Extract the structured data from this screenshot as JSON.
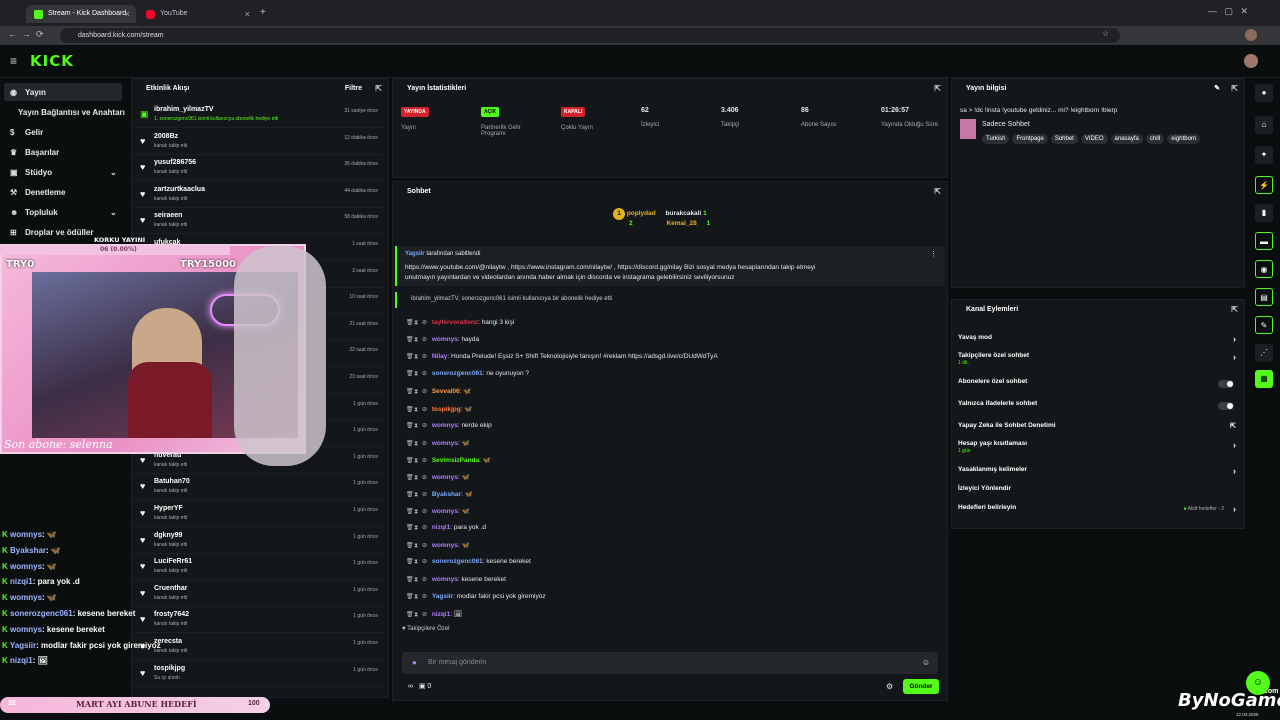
{
  "browser": {
    "tabs": [
      {
        "title": "Stream - Kick Dashboard"
      },
      {
        "title": "YouTube"
      }
    ],
    "url": "dashboard.kick.com/stream"
  },
  "logo": "KICK",
  "sidebar": {
    "items": [
      {
        "label": "Yayın",
        "icon": "broadcast-icon"
      },
      {
        "label": "Yayın Bağlantısı ve Anahtarı",
        "icon": "key-icon"
      },
      {
        "label": "Gelir",
        "icon": "money-icon"
      },
      {
        "label": "Başarılar",
        "icon": "trophy-icon"
      },
      {
        "label": "Stüdyo",
        "icon": "studio-icon"
      },
      {
        "label": "Denetleme",
        "icon": "gavel-icon"
      },
      {
        "label": "Topluluk",
        "icon": "community-icon"
      },
      {
        "label": "Droplar ve ödüller",
        "icon": "gift-icon"
      }
    ]
  },
  "activity": {
    "title": "Etkinlik Akışı",
    "filter": "Filtre",
    "items": [
      {
        "name": "ibrahim_yilmazTV",
        "sub": "1. sonerozgenc061 isimli kullanıcıya abonelik hediye etti",
        "time": "31 saniye önce"
      },
      {
        "name": "2008Bz",
        "sub": "kanalı takip etti",
        "time": "12 dakika önce"
      },
      {
        "name": "yusuf286756",
        "sub": "kanalı takip etti",
        "time": "35 dakika önce"
      },
      {
        "name": "zartzurtkaaclua",
        "sub": "kanalı takip etti",
        "time": "44 dakika önce"
      },
      {
        "name": "seiraeen",
        "sub": "kanalı takip etti",
        "time": "58 dakika önce"
      },
      {
        "name": "ufukcak",
        "sub": "",
        "time": "1 saat önce"
      },
      {
        "name": "eartam",
        "sub": "",
        "time": "3 saat önce"
      },
      {
        "name": "",
        "sub": "",
        "time": "10 saat önce"
      },
      {
        "name": "",
        "sub": "",
        "time": "21 saat önce"
      },
      {
        "name": "",
        "sub": "",
        "time": "22 saat önce"
      },
      {
        "name": "",
        "sub": "",
        "time": "23 saat önce"
      },
      {
        "name": "",
        "sub": "",
        "time": "1 gün önce"
      },
      {
        "name": "",
        "sub": "",
        "time": "1 gün önce"
      },
      {
        "name": "nuverad",
        "sub": "kanalı takip etti",
        "time": "1 gün önce"
      },
      {
        "name": "Batuhan70",
        "sub": "kanalı takip etti",
        "time": "1 gün önce"
      },
      {
        "name": "HyperYF",
        "sub": "kanalı takip etti",
        "time": "1 gün önce"
      },
      {
        "name": "dgkny99",
        "sub": "kanalı takip etti",
        "time": "1 gün önce"
      },
      {
        "name": "LuciFeRr61",
        "sub": "kanalı takip etti",
        "time": "1 gün önce"
      },
      {
        "name": "Cruenthar",
        "sub": "kanalı takip etti",
        "time": "1 gün önce"
      },
      {
        "name": "frosty7642",
        "sub": "kanalı takip etti",
        "time": "1 gün önce"
      },
      {
        "name": "zerecsta",
        "sub": "kanalı takip etti",
        "time": "1 gün önce"
      },
      {
        "name": "tospikjpg",
        "sub": "Su içi alındı",
        "time": "1 gün önce"
      }
    ]
  },
  "stats": {
    "title": "Yayın İstatistikleri",
    "items": [
      {
        "badge": "YAYINDA",
        "label": "Yayın",
        "color": "#d1232a"
      },
      {
        "badge": "AÇIK",
        "label": "Partnerlik Gelir Programı",
        "color": "#53fc18"
      },
      {
        "badge": "KAPALI",
        "label": "Çoklu Yayın",
        "color": "#d1232a"
      },
      {
        "value": "62",
        "label": "İzleyici"
      },
      {
        "value": "3.406",
        "label": "Takipçi"
      },
      {
        "value": "86",
        "label": "Abone Sayısı"
      },
      {
        "value": "01:26:57",
        "label": "Yayında Olduğu Süre"
      }
    ]
  },
  "chat": {
    "title": "Sohbet",
    "top": [
      {
        "rank": "1",
        "name": "poplydad",
        "count": "2"
      },
      {
        "name": "burakcakali",
        "count": "1"
      },
      {
        "name": "Kemal_28",
        "count": "1"
      }
    ],
    "pinned_by": "Yagsiir",
    "pinned_suffix": "tarafından sabitlendi",
    "pinned_text_1": "https://www.youtube.com/@nilaytw , https://www.instagram.com/nilaytw/ , https://discord.gg/nilay Bizi sosyal medya hesaplarından takip etmeyi",
    "pinned_text_2": "unutmayın yayınlardan ve videolardan anında haber almak için discorda ve instagrama gelebilirsiniz seviliyorsunuz",
    "gift_notice": "ibrahim_yilmazTV, sonerozgenc061 isimli kullanıcıya bir abonelik hediye etti",
    "messages": [
      {
        "user": "tayfervoraltenz",
        "text": ": hangi 3 kişi",
        "color": "#e0324b"
      },
      {
        "user": "womnys",
        "text": ": hayda",
        "color": "#b07cff"
      },
      {
        "user": "Nilay",
        "text": ": Honda Prelude! Eşsiz S+ Shift Teknolojisiyle tanışın! #reklam https://adsgd.live/c/DUdWdTyA",
        "color": "#b07cff"
      },
      {
        "user": "sonerozgenc061",
        "text": ": ne oyunuyon ?",
        "color": "#7aa8ff"
      },
      {
        "user": "Sevval06",
        "text": ": 🦋",
        "color": "#ff9a3c"
      },
      {
        "user": "tospikjpg",
        "text": ": 🦋",
        "color": "#ff7a3c"
      },
      {
        "user": "womnys",
        "text": ": nerde ekip",
        "color": "#b07cff"
      },
      {
        "user": "womnys",
        "text": ": 🦋",
        "color": "#b07cff"
      },
      {
        "user": "SevimsizPanda",
        "text": ": 🦋",
        "color": "#53fc18"
      },
      {
        "user": "womnys",
        "text": ": 🦋",
        "color": "#b07cff"
      },
      {
        "user": "Byakshar",
        "text": ": 🦋",
        "color": "#7aa8ff"
      },
      {
        "user": "womnys",
        "text": ": 🦋",
        "color": "#b07cff"
      },
      {
        "user": "nizqi1",
        "text": ": para yok .d",
        "color": "#b07cff"
      },
      {
        "user": "womnys",
        "text": ": 🦋",
        "color": "#b07cff"
      },
      {
        "user": "sonerozgenc061",
        "text": ": kesene bereket",
        "color": "#7aa8ff"
      },
      {
        "user": "womnys",
        "text": ": kesene bereket",
        "color": "#b07cff"
      },
      {
        "user": "Yagsiir",
        "text": ": modlar fakir pcsi yok giremiyoz",
        "color": "#7aa8ff"
      },
      {
        "user": "nizqi1",
        "text": ": 🖼",
        "color": "#b07cff"
      }
    ],
    "followers_only": "Takipçilere Özel",
    "placeholder": "Bir mesaj gönderin",
    "coins": "0",
    "send": "Gönder"
  },
  "stream_info": {
    "title": "Yayın bilgisi",
    "stream_title": "sa > !dc !insta !youtube geldiniz... mi? !eightborn !blerp",
    "category": "Sadece Sohbet",
    "tags": [
      "Turkish",
      "Frontpage",
      "Sohbet",
      "VIDEO",
      "anasayfa",
      "chill",
      "eightborn"
    ]
  },
  "channel_actions": {
    "title": "Kanal Eylemleri",
    "items": [
      {
        "label": "Yavaş mod",
        "sub": "",
        "control": "arrow"
      },
      {
        "label": "Takipçilere özel sohbet",
        "sub": "1 dk.",
        "control": "arrow"
      },
      {
        "label": "Abonelere özel sohbet",
        "sub": "",
        "control": "toggle"
      },
      {
        "label": "Yalnızca ifadelerle sohbet",
        "sub": "",
        "control": "toggle"
      },
      {
        "label": "Yapay Zeka ile Sohbet Denetimi",
        "sub": "",
        "control": "link"
      },
      {
        "label": "Hesap yaşı kısıtlaması",
        "sub": "1 gün",
        "control": "arrow"
      },
      {
        "label": "Yasaklanmış kelimeler",
        "sub": "",
        "control": "arrow"
      },
      {
        "label": "İzleyici Yönlendir",
        "sub": "",
        "control": "none"
      },
      {
        "label": "Hedefleri belirleyin",
        "sub": "",
        "control": "arrow",
        "extra": "Aktif hedefler - 2"
      }
    ]
  },
  "overlay": {
    "korku": "KORKU YAYINI",
    "korku_progress": "06 (0.00%)",
    "try_left": "TRY0",
    "try_right": "TRY15000",
    "son_abone": "Son abone: selenna",
    "goal_count": "32",
    "goal_label": "MART AYI ABUNE HEDEFİ",
    "goal_total": "100",
    "watermark": "ByNoGame",
    "watermark_tld": ".com",
    "watermark_date": "12.03.2025",
    "chat": [
      {
        "user": "womnys",
        "text": ": 🦋"
      },
      {
        "user": "Byakshar",
        "text": ": 🦋"
      },
      {
        "user": "womnys",
        "text": ": 🦋"
      },
      {
        "user": "nizqi1",
        "text": ": para yok .d"
      },
      {
        "user": "womnys",
        "text": ": 🦋"
      },
      {
        "user": "sonerozgenc061",
        "text": ": kesene bereket"
      },
      {
        "user": "womnys",
        "text": ": kesene bereket"
      },
      {
        "user": "Yagsiir",
        "text": ": modlar fakir pcsi yok giremiyoz"
      },
      {
        "user": "nizqi1",
        "text": ": 🖼"
      }
    ]
  }
}
